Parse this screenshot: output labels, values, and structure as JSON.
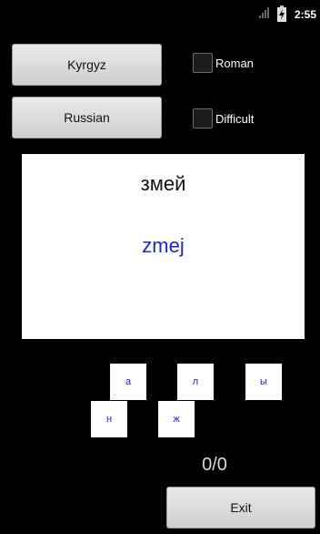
{
  "status": {
    "time": "2:55"
  },
  "buttons": {
    "kyrgyz": "Kyrgyz",
    "russian": "Russian",
    "exit": "Exit"
  },
  "options": {
    "roman": "Roman",
    "difficult": "Difficult"
  },
  "card": {
    "native": "змей",
    "romanized": "zmej"
  },
  "letters": [
    "а",
    "л",
    "ы",
    "н",
    "ж"
  ],
  "score": "0/0"
}
